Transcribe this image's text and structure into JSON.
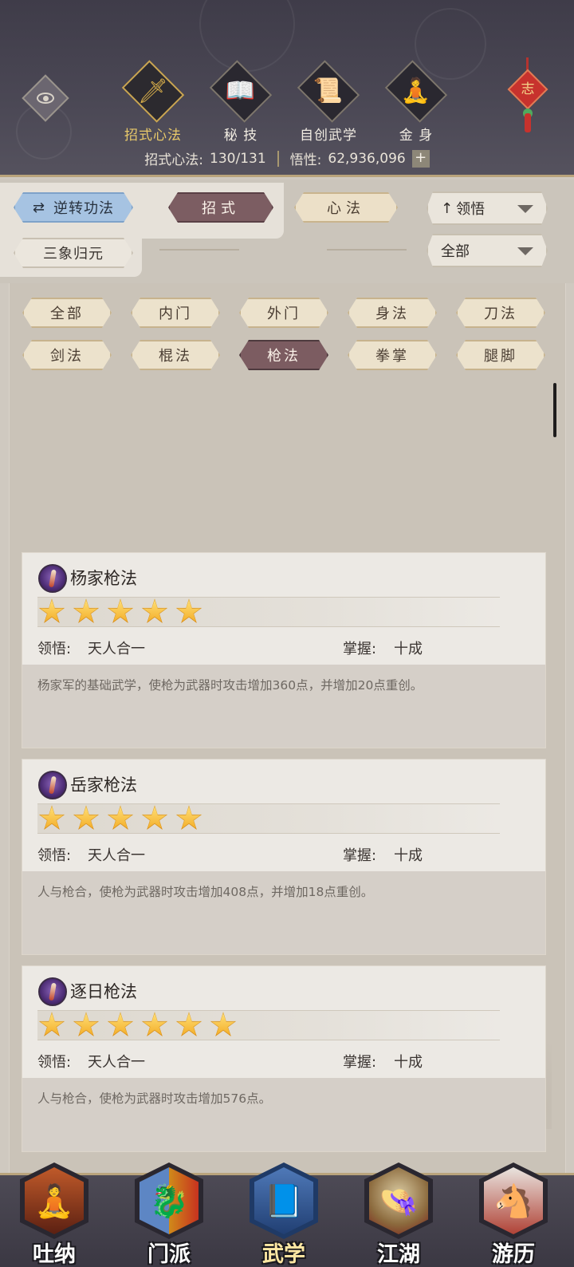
{
  "header": {
    "tabs": [
      {
        "label": "招式心法",
        "icon": "sword-icon",
        "glyph": "🗡",
        "active": true
      },
      {
        "label": "秘 技",
        "icon": "book-icon",
        "glyph": "📖",
        "active": false
      },
      {
        "label": "自创武学",
        "icon": "scroll-icon",
        "glyph": "📜",
        "active": false
      },
      {
        "label": "金 身",
        "icon": "meditation-icon",
        "glyph": "🧘",
        "active": false
      }
    ],
    "knot_char": "志",
    "stats": {
      "moves_label": "招式心法:",
      "moves_value": "130/131",
      "insight_label": "悟性:",
      "insight_value": "62,936,096",
      "plus": "+"
    }
  },
  "filters": {
    "reverse_btn": "逆转功法",
    "reverse_icon": "⇄",
    "type_moves": "招式",
    "type_mind": "心法",
    "sort_select": "领悟",
    "sort_icon": "↑",
    "sanxiang_btn": "三象归元",
    "all_select": "全部"
  },
  "categories": [
    "全部",
    "内门",
    "外门",
    "身法",
    "刀法",
    "剑法",
    "棍法",
    "枪法",
    "拳掌",
    "腿脚"
  ],
  "selected_category": "枪法",
  "skills": [
    {
      "name": "杨家枪法",
      "stars": 5,
      "insight_label": "领悟:",
      "insight_value": "天人合一",
      "mastery_label": "掌握:",
      "mastery_value": "十成",
      "desc": "杨家军的基础武学，使枪为武器时攻击增加360点，并增加20点重创。"
    },
    {
      "name": "岳家枪法",
      "stars": 5,
      "insight_label": "领悟:",
      "insight_value": "天人合一",
      "mastery_label": "掌握:",
      "mastery_value": "十成",
      "desc": "人与枪合，使枪为武器时攻击增加408点，并增加18点重创。"
    },
    {
      "name": "逐日枪法",
      "stars": 6,
      "insight_label": "领悟:",
      "insight_value": "天人合一",
      "mastery_label": "掌握:",
      "mastery_value": "十成",
      "desc": "人与枪合，使枪为武器时攻击增加576点。"
    }
  ],
  "bottom_nav": [
    {
      "label": "吐纳",
      "icon": "monk-icon",
      "glyph": "🧘",
      "active": false
    },
    {
      "label": "门派",
      "icon": "sect-banner-icon",
      "glyph": "🐉",
      "active": false
    },
    {
      "label": "武学",
      "icon": "martial-book-icon",
      "glyph": "📘",
      "active": true
    },
    {
      "label": "江湖",
      "icon": "straw-hat-icon",
      "glyph": "👒",
      "active": false
    },
    {
      "label": "游历",
      "icon": "horse-icon",
      "glyph": "🐴",
      "active": false
    }
  ],
  "colors": {
    "header_bg": "#4b4855",
    "accent_gold": "#e8c96a",
    "selected_pill": "#7c5d62",
    "blue_pill": "#a6c3e2"
  }
}
